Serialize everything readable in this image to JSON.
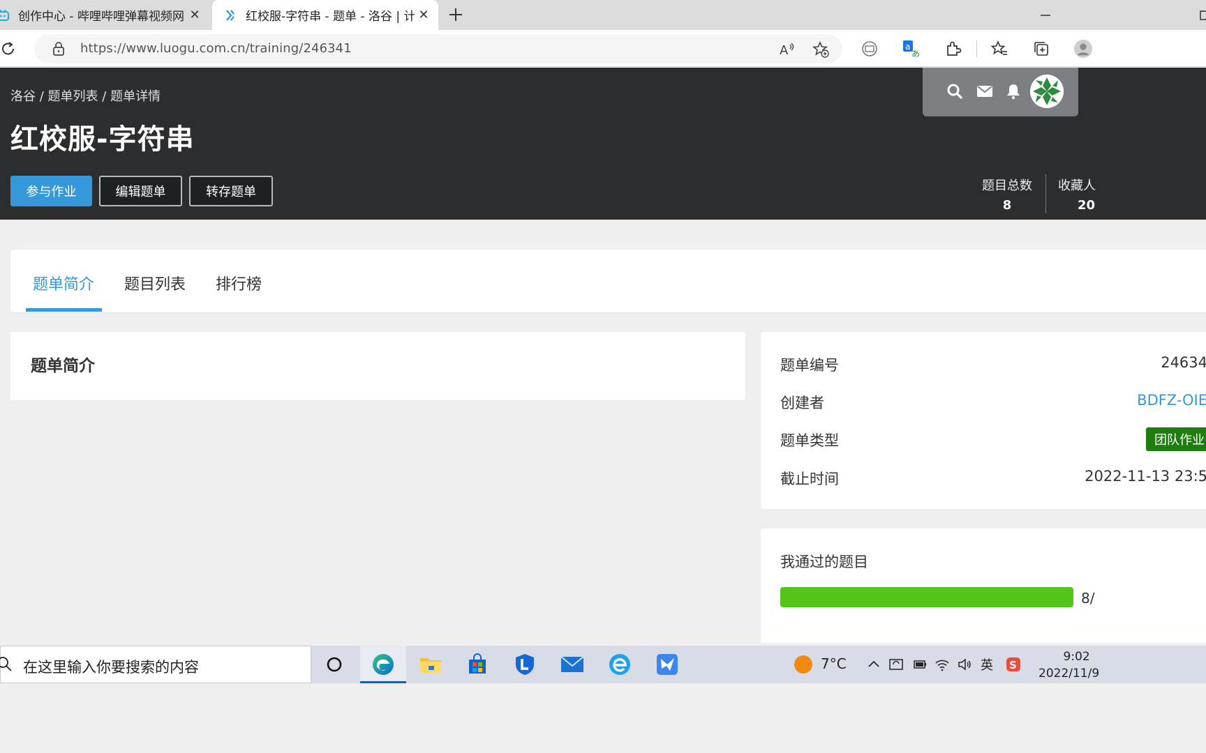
{
  "browser": {
    "tabs": [
      {
        "title": "创作中心 - 哔哩哔哩弹幕视频网",
        "active": false,
        "icon": "bilibili-icon"
      },
      {
        "title": "红校服-字符串 - 题单 - 洛谷 | 计",
        "active": true,
        "icon": "luogu-icon"
      }
    ],
    "url": "https://www.luogu.com.cn/training/246341"
  },
  "header": {
    "breadcrumb": [
      "洛谷",
      "题单列表",
      "题单详情"
    ],
    "breadcrumb_sep": "/",
    "title": "红校服-字符串",
    "buttons": {
      "join": "参与作业",
      "edit": "编辑题单",
      "save": "转存题单"
    },
    "stats": [
      {
        "label": "题目总数",
        "value": "8"
      },
      {
        "label": "收藏人",
        "value": "20"
      }
    ]
  },
  "tabs": {
    "items": [
      "题单简介",
      "题目列表",
      "排行榜"
    ],
    "active": "题单简介"
  },
  "intro": {
    "heading": "题单简介"
  },
  "info": {
    "id_label": "题单编号",
    "id_value": "24634",
    "creator_label": "创建者",
    "creator_value": "BDFZ-OIE",
    "type_label": "题单类型",
    "type_value": "团队作业",
    "deadline_label": "截止时间",
    "deadline_value": "2022-11-13 23:5"
  },
  "progress": {
    "heading": "我通过的题目",
    "text": "8/",
    "fraction": 1.0,
    "color": "#52c41a"
  },
  "colors": {
    "accent": "#3498db",
    "header_bg": "#2b2d2f",
    "badge": "#1e7d0e"
  },
  "taskbar": {
    "search_placeholder": "在这里输入你要搜索的内容",
    "temperature": "7°C",
    "ime": "英",
    "time": "9:02",
    "date": "2022/11/9"
  }
}
